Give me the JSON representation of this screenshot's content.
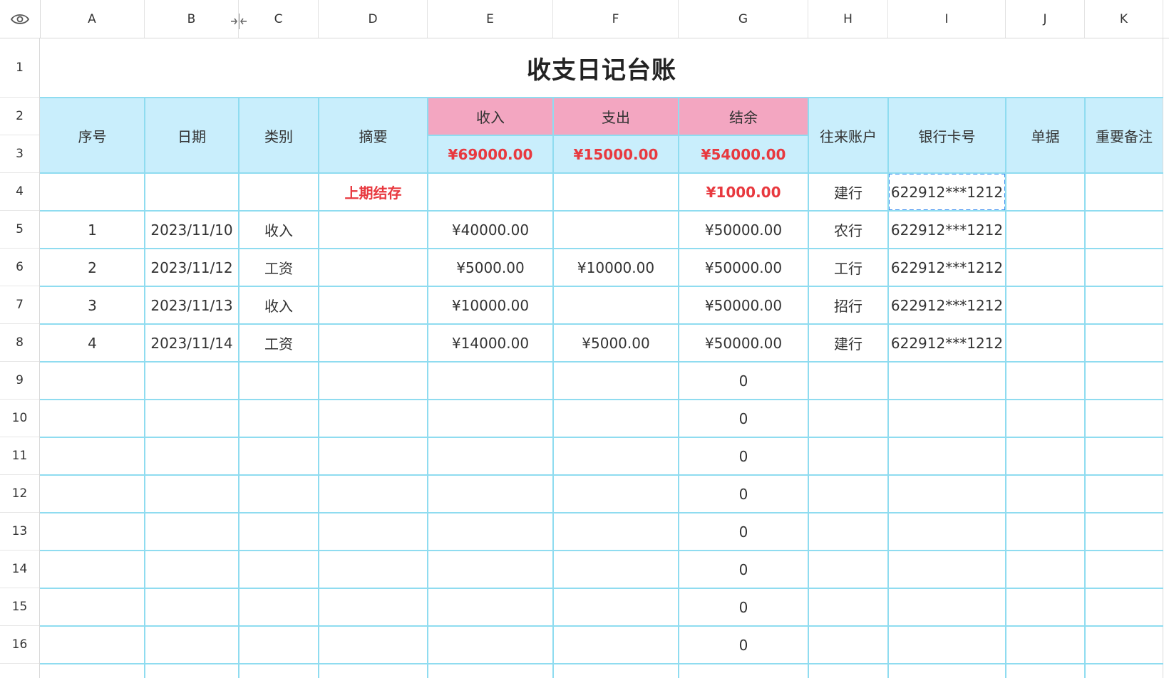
{
  "columns": [
    "A",
    "B",
    "C",
    "D",
    "E",
    "F",
    "G",
    "H",
    "I",
    "J",
    "K"
  ],
  "rows": [
    "1",
    "2",
    "3",
    "4",
    "5",
    "6",
    "7",
    "8",
    "9",
    "10",
    "11",
    "12",
    "13",
    "14",
    "15",
    "16"
  ],
  "title": "收支日记台账",
  "headers": {
    "seq": "序号",
    "date": "日期",
    "category": "类别",
    "summary": "摘要",
    "income": "收入",
    "expense": "支出",
    "balance": "结余",
    "account": "往来账户",
    "card": "银行卡号",
    "voucher": "单据",
    "notes": "重要备注"
  },
  "totals": {
    "income": "¥69000.00",
    "expense": "¥15000.00",
    "balance": "¥54000.00"
  },
  "opening": {
    "summary": "上期结存",
    "balance": "¥1000.00",
    "account": "建行",
    "card": "622912***1212"
  },
  "entries": [
    {
      "seq": "1",
      "date": "2023/11/10",
      "category": "收入",
      "income": "¥40000.00",
      "expense": "",
      "balance": "¥50000.00",
      "account": "农行",
      "card": "622912***1212"
    },
    {
      "seq": "2",
      "date": "2023/11/12",
      "category": "工资",
      "income": "¥5000.00",
      "expense": "¥10000.00",
      "balance": "¥50000.00",
      "account": "工行",
      "card": "622912***1212"
    },
    {
      "seq": "3",
      "date": "2023/11/13",
      "category": "收入",
      "income": "¥10000.00",
      "expense": "",
      "balance": "¥50000.00",
      "account": "招行",
      "card": "622912***1212"
    },
    {
      "seq": "4",
      "date": "2023/11/14",
      "category": "工资",
      "income": "¥14000.00",
      "expense": "¥5000.00",
      "balance": "¥50000.00",
      "account": "建行",
      "card": "622912***1212"
    }
  ],
  "empty_balances": [
    "0",
    "0",
    "0",
    "0",
    "0",
    "0",
    "0",
    "0"
  ],
  "icons": {
    "visibility": "eye-icon",
    "resize": "column-resize-icon"
  },
  "colors": {
    "header_blue": "#c9eefc",
    "header_pink": "#f3a6c1",
    "grid": "#8fdcf0",
    "accent_red": "#e8393f"
  }
}
